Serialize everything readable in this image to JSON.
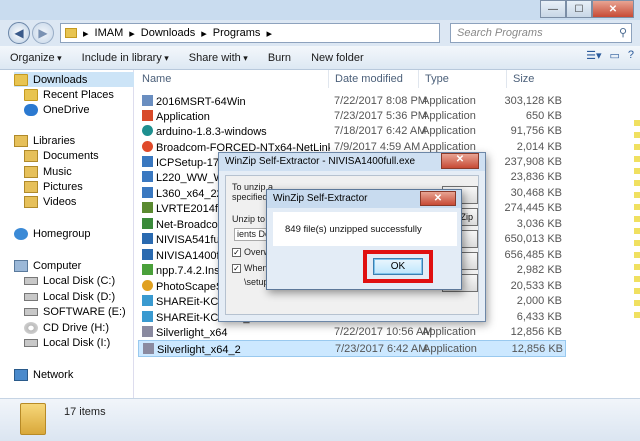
{
  "breadcrumb": [
    "IMAM",
    "Downloads",
    "Programs"
  ],
  "search": {
    "placeholder": "Search Programs"
  },
  "toolbar": {
    "organize": "Organize",
    "include": "Include in library",
    "share": "Share with",
    "burn": "Burn",
    "new_folder": "New folder"
  },
  "nav": {
    "favorites": [
      "Downloads",
      "Recent Places",
      "OneDrive"
    ],
    "libraries": "Libraries",
    "library_items": [
      "Documents",
      "Music",
      "Pictures",
      "Videos"
    ],
    "homegroup": "Homegroup",
    "computer": "Computer",
    "drives": [
      "Local Disk (C:)",
      "Local Disk (D:)",
      "SOFTWARE (E:)",
      "CD Drive (H:)",
      "Local Disk (I:)"
    ],
    "network": "Network"
  },
  "columns": {
    "name": "Name",
    "date": "Date modified",
    "type": "Type",
    "size": "Size"
  },
  "files": [
    {
      "name": "2016MSRT-64Win",
      "date": "7/22/2017 8:08 PM",
      "type": "Application",
      "size": "303,128 KB"
    },
    {
      "name": "Application",
      "date": "7/23/2017 5:36 PM",
      "type": "Application",
      "size": "650 KB"
    },
    {
      "name": "arduino-1.8.3-windows",
      "date": "7/18/2017 6:42 AM",
      "type": "Application",
      "size": "91,756 KB"
    },
    {
      "name": "Broadcom-FORCED-NTx64-NetLink 15.6...",
      "date": "7/9/2017 4:59 AM",
      "type": "Application",
      "size": "2,014 KB"
    },
    {
      "name": "ICPSetup-1700f",
      "date": "",
      "type": "",
      "size": "237,908 KB"
    },
    {
      "name": "L220_WW_WIN_",
      "date": "",
      "type": "",
      "size": "23,836 KB"
    },
    {
      "name": "L360_x64_222JA",
      "date": "",
      "type": "",
      "size": "30,468 KB"
    },
    {
      "name": "LVRTE2014f2std",
      "date": "",
      "type": "",
      "size": "274,445 KB"
    },
    {
      "name": "Net-Broadcom-",
      "date": "",
      "type": "",
      "size": "3,036 KB"
    },
    {
      "name": "NIVISA541full",
      "date": "",
      "type": "",
      "size": "650,013 KB"
    },
    {
      "name": "NIVISA1400full",
      "date": "",
      "type": "",
      "size": "656,485 KB"
    },
    {
      "name": "npp.7.4.2.Installe",
      "date": "",
      "type": "",
      "size": "2,982 KB"
    },
    {
      "name": "PhotoScapeSetu",
      "date": "",
      "type": "",
      "size": "20,533 KB"
    },
    {
      "name": "SHAREit-KCWEB",
      "date": "",
      "type": "",
      "size": "2,000 KB"
    },
    {
      "name": "SHAREit-KCWEB_2",
      "date": "",
      "type": "",
      "size": "6,433 KB"
    },
    {
      "name": "Silverlight_x64",
      "date": "7/22/2017 10:56 AM",
      "type": "Application",
      "size": "12,856 KB"
    },
    {
      "name": "Silverlight_x64_2",
      "date": "7/23/2017 6:42 AM",
      "type": "Application",
      "size": "12,856 KB"
    }
  ],
  "status": {
    "count": "17 items"
  },
  "extractor": {
    "title": "WinZip Self-Extractor - NIVISA1400full.exe",
    "line1": "To unzip a",
    "line2": "specified fo",
    "unzip_to": "Unzip to fo",
    "path": "ients Dow",
    "overwrite": "Overwrit",
    "when": "When c",
    "setup": "\\setup",
    "btn_unzip": "zip",
    "btn_winzip": "WinZip",
    "btn_close": "ose",
    "btn_about": "out",
    "btn_help": "elp"
  },
  "message_box": {
    "title": "WinZip Self-Extractor",
    "text": "849 file(s) unzipped successfully",
    "ok": "OK"
  }
}
